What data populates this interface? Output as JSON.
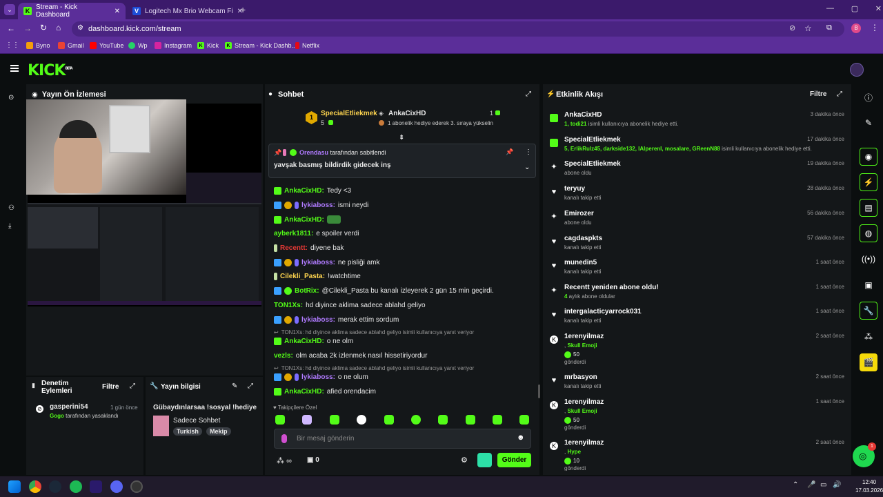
{
  "browser": {
    "tabs": [
      {
        "label": "Stream - Kick Dashboard",
        "active": true
      },
      {
        "label": "Logitech Mx Brio Webcam Fiyat…",
        "active": false
      }
    ],
    "url": "dashboard.kick.com/stream",
    "bookmarks": [
      "Byno",
      "Gmail",
      "YouTube",
      "Wp",
      "Instagram",
      "Kick",
      "Stream - Kick Dashb...",
      "Netflix"
    ]
  },
  "kick": {
    "logo": "KICK",
    "logo_sup": "BETA"
  },
  "preview": {
    "title": "Yayın Ön İzlemesi"
  },
  "moderation": {
    "title": "Denetim Eylemleri",
    "filter": "Filtre",
    "user": "gasperini54",
    "time": "1 gün önce",
    "by_user": "Gogo",
    "by_text": "tarafından yasaklandı"
  },
  "streaminfo": {
    "title": "Yayın bilgisi",
    "stream_title": "Gübaydınlarsaa !sosyal !hediye",
    "category": "Sadece Sohbet",
    "tags": [
      "Turkish",
      "Mekip"
    ]
  },
  "chat": {
    "title": "Sohbet",
    "sub_user": "SpecialEtliekmek",
    "sub_count": "5",
    "sub_level": "1",
    "gift_user": "AnkaCixHD",
    "gift_count": "1",
    "gift_text": "1 abonelik hediye ederek 3. sıraya yükselin",
    "pinned_by": "Orendasu",
    "pinned_by_text": "tarafından sabitlendi",
    "pinned_msg": "yavşak basmış bildirdik gidecek inş",
    "lines": [
      {
        "user": "AnkaCixHD:",
        "msg": "Tedy <3",
        "color": "#53fc18"
      },
      {
        "user": "lykiaboss:",
        "msg": "ismi neydi",
        "color": "#b07bff"
      },
      {
        "user": "AnkaCixHD:",
        "msg": "",
        "color": "#53fc18"
      },
      {
        "user": "ayberk1811:",
        "msg": "e spoiler verdi",
        "color": "#53fc18"
      },
      {
        "user": "Recentt:",
        "msg": "diyene bak",
        "color": "#e53935"
      },
      {
        "user": "lykiaboss:",
        "msg": "ne pisliği amk",
        "color": "#b07bff"
      },
      {
        "user": "Cilekli_Pasta:",
        "msg": "!watchtime",
        "color": "#ffd54f"
      },
      {
        "user": "BotRix:",
        "msg": "@Cilekli_Pasta bu kanalı izleyerek 2 gün 15 min geçirdi.",
        "color": "#53fc18"
      },
      {
        "user": "TON1Xs:",
        "msg": "hd diyince aklima sadece ablahd geliyo",
        "color": "#53fc18"
      },
      {
        "user": "lykiaboss:",
        "msg": "merak ettim sordum",
        "color": "#b07bff"
      },
      {
        "user": "AnkaCixHD:",
        "msg": "o ne olm",
        "color": "#53fc18"
      },
      {
        "user": "vezls:",
        "msg": "olm acaba 2k izlenmek nasıl hissetiriyordur",
        "color": "#53fc18"
      },
      {
        "user": "lykiaboss:",
        "msg": "o ne olum",
        "color": "#b07bff"
      },
      {
        "user": "AnkaCixHD:",
        "msg": "afied orendacim",
        "color": "#53fc18"
      }
    ],
    "reply1": "TON1Xs: hd diyince aklima sadece ablahd geliyo isimli kullanıcıya yanıt veriyor",
    "reply2": "TON1Xs: hd diyince aklima sadece ablahd geliyo isimli kullanıcıya yanıt veriyor",
    "emote_tab": "Takipçilere Özel",
    "placeholder": "Bir mesaj gönderin",
    "points": "∞",
    "gift_points": "0",
    "send": "Gönder"
  },
  "activity": {
    "title": "Etkinlik Akışı",
    "filter": "Filtre",
    "events": [
      {
        "icon": "gift-icon",
        "name": "AnkaCixHD",
        "time": "3 dakika önce",
        "prefix": "1, todi21",
        "sub": " isimli kullanıcıya abonelik hediye etti."
      },
      {
        "icon": "gift-icon",
        "name": "SpecialEtliekmek",
        "time": "17 dakika önce",
        "prefix": "5, ErlikRulz45, darkside132, IAlperenI, mosalare, GReenN88",
        "sub": " isimli kullanıcıya abonelik hediye etti."
      },
      {
        "icon": "star-icon",
        "name": "SpecialEtliekmek",
        "time": "19 dakika önce",
        "prefix": "",
        "sub": "abone oldu"
      },
      {
        "icon": "heart-icon",
        "name": "teryuy",
        "time": "28 dakika önce",
        "prefix": "",
        "sub": "kanalı takip etti"
      },
      {
        "icon": "star-icon",
        "name": "Emirozer",
        "time": "56 dakika önce",
        "prefix": "",
        "sub": "abone oldu"
      },
      {
        "icon": "heart-icon",
        "name": "cagdaspkts",
        "time": "57 dakika önce",
        "prefix": "",
        "sub": "kanalı takip etti"
      },
      {
        "icon": "heart-icon",
        "name": "munedin5",
        "time": "1 saat önce",
        "prefix": "",
        "sub": "kanalı takip etti"
      },
      {
        "icon": "star-icon",
        "name": "Recentt yeniden abone oldu!",
        "time": "1 saat önce",
        "prefix": "4",
        "sub": " aylık abone oldular"
      },
      {
        "icon": "heart-icon",
        "name": "intergalacticyarrock031",
        "time": "1 saat önce",
        "prefix": "",
        "sub": "kanalı takip etti"
      }
    ],
    "kicks": [
      {
        "name": "1erenyilmaz",
        "time": "2 saat önce",
        "item": "Skull Emoji",
        "amount": "50",
        "sub": "gönderdi"
      },
      {
        "name": "mrbasyon",
        "time": "2 saat önce",
        "item": "",
        "amount": "",
        "sub": "kanalı takip etti"
      },
      {
        "name": "1erenyilmaz",
        "time": "1 saat önce",
        "item": "Skull Emoji",
        "amount": "50",
        "sub": "gönderdi"
      },
      {
        "name": "1erenyilmaz",
        "time": "2 saat önce",
        "item": "Hype",
        "amount": "10",
        "sub": "gönderdi"
      }
    ]
  },
  "taskbar": {
    "time": "12:40",
    "date": "17.03.2026",
    "badge": "1"
  }
}
